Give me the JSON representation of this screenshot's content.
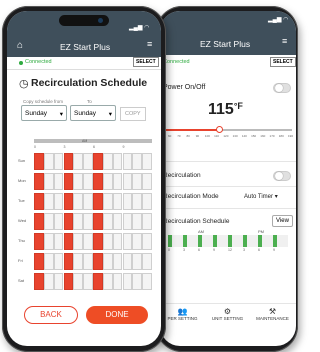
{
  "back_phone": {
    "app_title": "EZ Start Plus",
    "status_label": "Connected",
    "select_label": "SELECT",
    "power_label": "Power On/Off",
    "temperature_value": "115",
    "temperature_unit": "°F",
    "slider_ticks": [
      "60",
      "70",
      "80",
      "90",
      "100",
      "110",
      "120",
      "130",
      "140",
      "150",
      "160",
      "170",
      "180",
      "190"
    ],
    "slider_level_f": 115,
    "recirculation_label": "Recirculation",
    "recirc_mode_label": "Recirculation Mode",
    "recirc_mode_value": "Auto Timer",
    "recirc_schedule_label": "Recirculation Schedule",
    "view_label": "View",
    "mini_schedule_header": [
      "AM",
      "PM"
    ],
    "mini_schedule_ticks": [
      "0",
      "3",
      "6",
      "9",
      "12",
      "3",
      "6",
      "9"
    ],
    "nav": [
      {
        "label": "PER SETTING",
        "icon": "users-icon"
      },
      {
        "label": "UNIT SETTING",
        "icon": "gear-icon"
      },
      {
        "label": "MAINTENANCE",
        "icon": "tools-icon"
      }
    ]
  },
  "front_phone": {
    "app_title": "EZ Start Plus",
    "status_label": "Connected",
    "select_label": "SELECT",
    "page_title": "Recirculation Schedule",
    "copy_from_label": "Copy schedule from",
    "copy_to_label": "To",
    "from_value": "Sunday",
    "to_value": "Sunday",
    "copy_button": "COPY",
    "grid_header": "AM",
    "grid_ticks": [
      "0",
      "3",
      "6",
      "9"
    ],
    "days": [
      "Sun",
      "Mon",
      "Tue",
      "Wed",
      "Thu",
      "Fri",
      "Sat"
    ],
    "on_columns": [
      0,
      3,
      6
    ],
    "back_button": "BACK",
    "done_button": "DONE"
  },
  "colors": {
    "appbar": "#3f4f5b",
    "accent": "#e8432e",
    "connected": "#2eaa3f",
    "mini_bar": "#4caf50"
  }
}
